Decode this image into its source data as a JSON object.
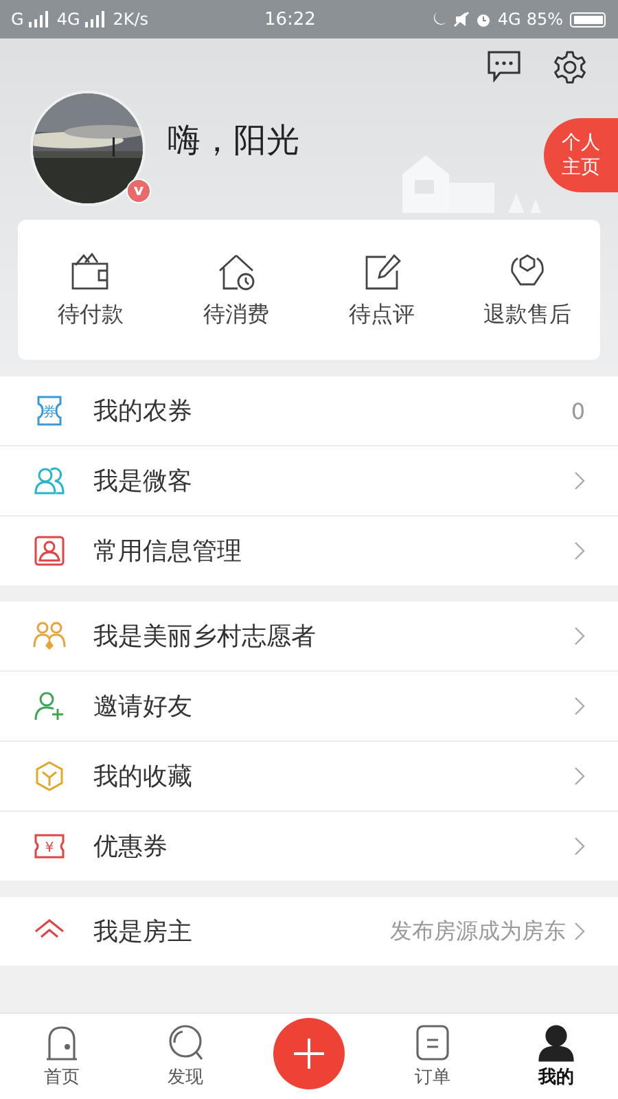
{
  "status_bar": {
    "carrier_1": "G",
    "carrier_2": "4G",
    "speed": "2K/s",
    "time": "16:22",
    "network": "4G",
    "battery": "85%"
  },
  "profile": {
    "greeting": "嗨，阳光",
    "badge": "v",
    "homepage_button": "个人主页"
  },
  "order_shortcuts": [
    {
      "label": "待付款"
    },
    {
      "label": "待消费"
    },
    {
      "label": "待点评"
    },
    {
      "label": "退款售后"
    }
  ],
  "menu_groups": [
    [
      {
        "icon_text": "券",
        "color": "#3a9ad9",
        "label": "我的农券",
        "value": "0"
      },
      {
        "color": "#27b5c9",
        "label": "我是微客"
      },
      {
        "color": "#e04545",
        "label": "常用信息管理"
      }
    ],
    [
      {
        "color": "#e8a436",
        "label": "我是美丽乡村志愿者"
      },
      {
        "color": "#3fa455",
        "label": "邀请好友"
      },
      {
        "color": "#e2a72e",
        "label": "我的收藏"
      },
      {
        "icon_text": "¥",
        "color": "#e04545",
        "label": "优惠券"
      }
    ],
    [
      {
        "color": "#e04545",
        "label": "我是房主",
        "hint": "发布房源成为房东"
      }
    ]
  ],
  "tab_bar": [
    {
      "kind": "tab",
      "label": "首页",
      "selected": false
    },
    {
      "kind": "tab",
      "label": "发现",
      "selected": false
    },
    {
      "kind": "add"
    },
    {
      "kind": "tab",
      "label": "订单",
      "selected": false
    },
    {
      "kind": "tab",
      "label": "我的",
      "selected": true
    }
  ]
}
